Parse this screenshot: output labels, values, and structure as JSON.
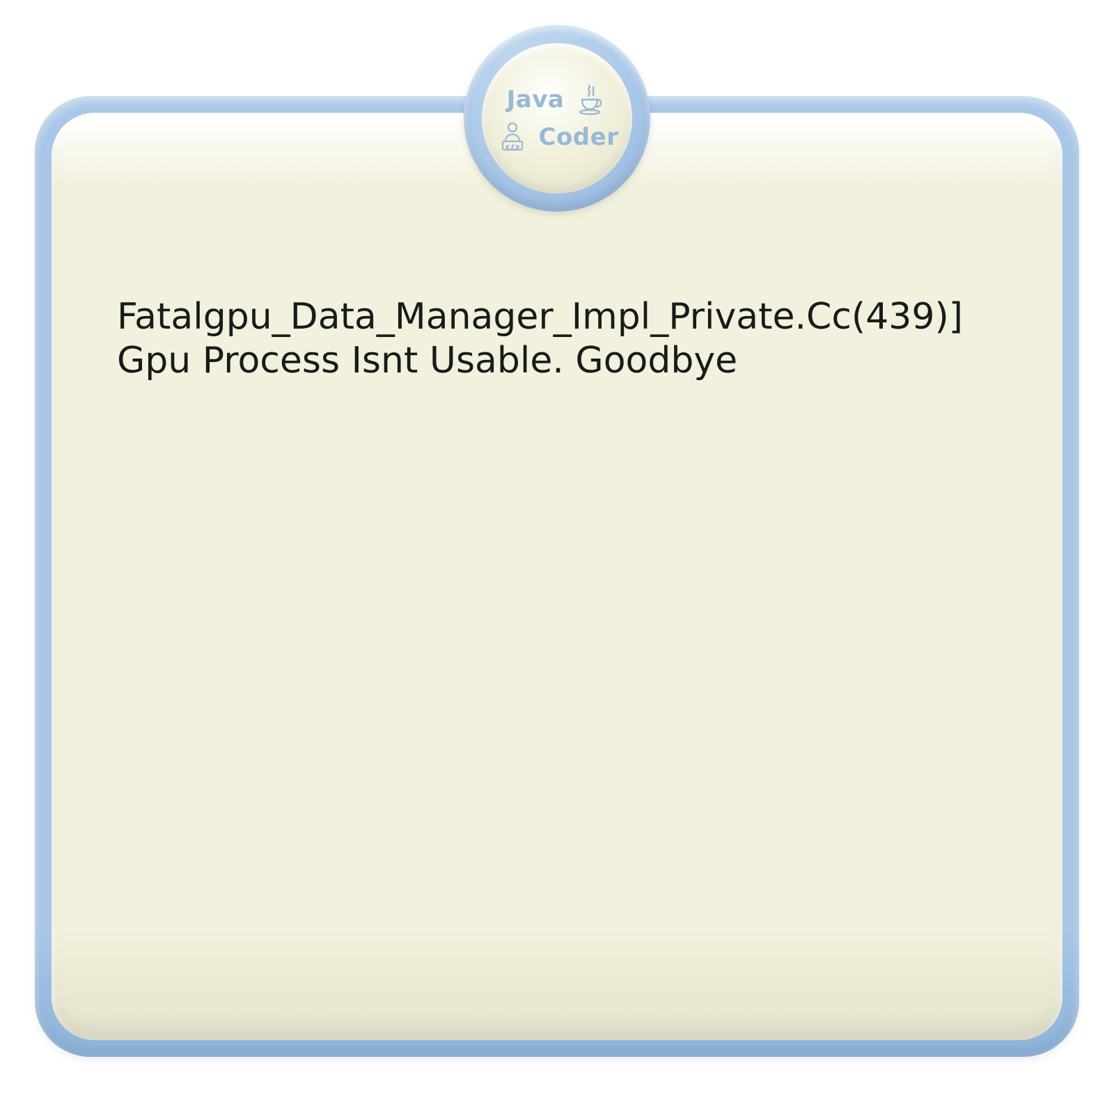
{
  "badge": {
    "top_text": "Java",
    "bottom_text": "Coder",
    "cup_icon_name": "java-cup-icon",
    "person_icon_name": "developer-icon"
  },
  "message": {
    "text": "Fatalgpu_Data_Manager_Impl_Private.Cc(439)] Gpu Process Isnt Usable. Goodbye"
  },
  "colors": {
    "frame": "#a9c7e8",
    "panel": "#f2f1dd",
    "text": "#1a1a1a",
    "badge_text": "#98b9d5"
  }
}
